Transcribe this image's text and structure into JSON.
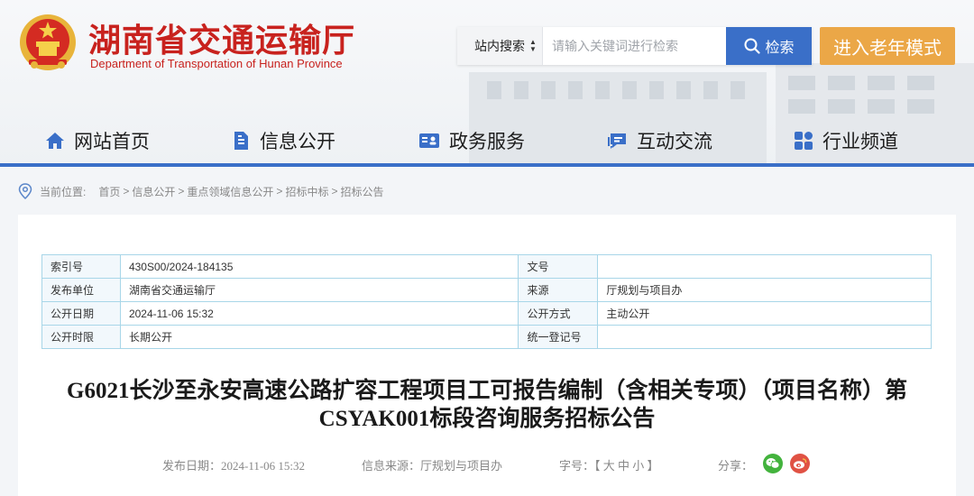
{
  "site": {
    "name_cn": "湖南省交通运输厅",
    "name_en": "Department of Transportation of Hunan Province"
  },
  "search": {
    "scope": "站内搜索",
    "placeholder": "请输入关键词进行检索",
    "button": "检索"
  },
  "elder_mode": "进入老年模式",
  "nav": [
    {
      "label": "网站首页",
      "icon": "home-icon"
    },
    {
      "label": "信息公开",
      "icon": "document-icon"
    },
    {
      "label": "政务服务",
      "icon": "id-card-icon"
    },
    {
      "label": "互动交流",
      "icon": "chat-icon"
    },
    {
      "label": "行业频道",
      "icon": "grid-icon"
    }
  ],
  "breadcrumb": {
    "label": "当前位置:",
    "items": [
      "首页",
      "信息公开",
      "重点领域信息公开",
      "招标中标",
      "招标公告"
    ],
    "separator": ">"
  },
  "meta": {
    "rows": [
      {
        "k1": "索引号",
        "v1": "430S00/2024-184135",
        "k2": "文号",
        "v2": ""
      },
      {
        "k1": "发布单位",
        "v1": "湖南省交通运输厅",
        "k2": "来源",
        "v2": "厅规划与项目办"
      },
      {
        "k1": "公开日期",
        "v1": "2024-11-06 15:32",
        "k2": "公开方式",
        "v2": "主动公开"
      },
      {
        "k1": "公开时限",
        "v1": "长期公开",
        "k2": "统一登记号",
        "v2": ""
      }
    ]
  },
  "article": {
    "title_line1": "G6021长沙至永安高速公路扩容工程项目工可报告编制（含相关专项）（项目名称）第",
    "title_line2": "CSYAK001标段咨询服务招标公告",
    "publish_date": "发布日期：2024-11-06 15:32",
    "source": "信息来源：厅规划与项目办",
    "font_size": "字号：【 大 中 小 】",
    "share_label": "分享："
  },
  "colors": {
    "brand_red": "#c8221e",
    "accent_blue": "#3a6fc8",
    "elder_orange": "#eba747",
    "table_border": "#a8d6e8",
    "wechat_green": "#43b33d",
    "weibo_red": "#e05244"
  }
}
